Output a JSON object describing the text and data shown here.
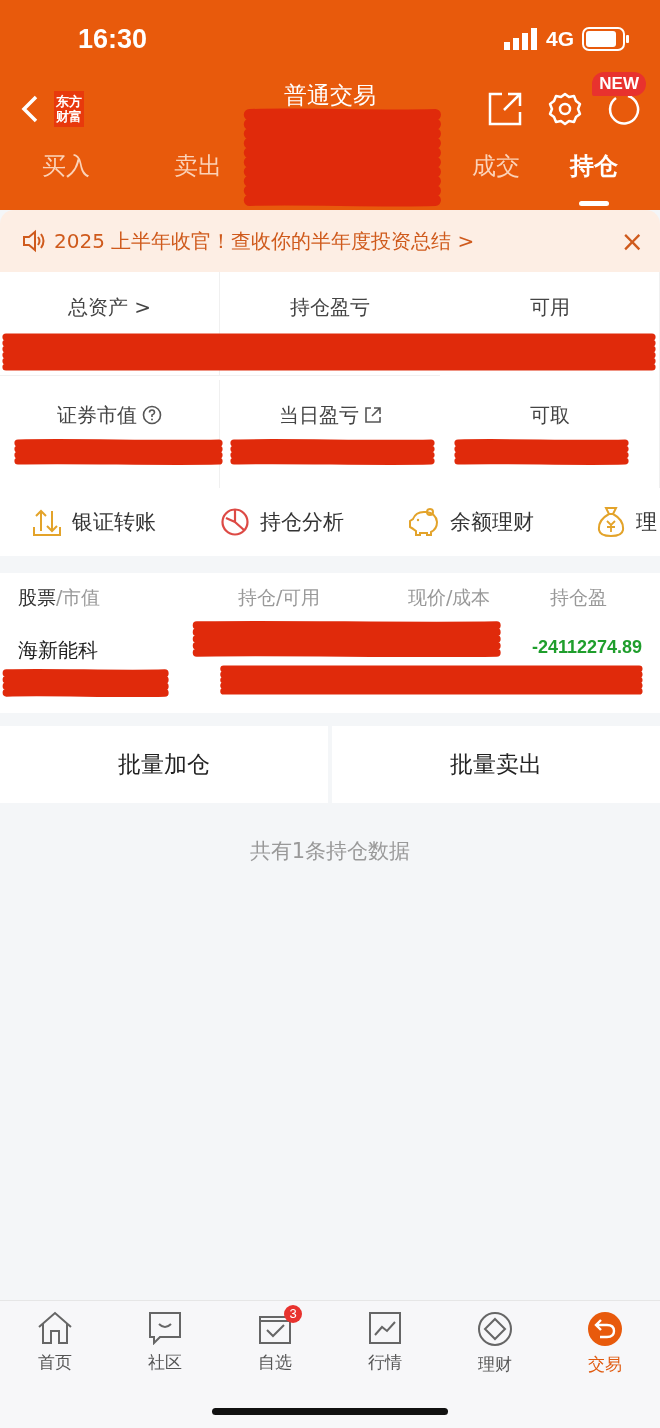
{
  "status_bar": {
    "time": "16:30",
    "network": "4G"
  },
  "header": {
    "logo_lines": [
      "东方",
      "财富"
    ],
    "title": "普通交易",
    "badge": "NEW"
  },
  "tabs": [
    {
      "label": "买入",
      "selected": false
    },
    {
      "label": "卖出",
      "selected": false
    },
    {
      "label": "成交",
      "selected": false
    },
    {
      "label": "持仓",
      "selected": true
    }
  ],
  "banner": {
    "text": "2025 上半年收官！查收你的半年度投资总结 >",
    "close": "×"
  },
  "summary": [
    {
      "label": "总资产 >"
    },
    {
      "label": "持仓盈亏"
    },
    {
      "label": "可用"
    },
    {
      "label": "证券市值"
    },
    {
      "label": "当日盈亏"
    },
    {
      "label": "可取"
    }
  ],
  "shortcuts": [
    {
      "label": "银证转账"
    },
    {
      "label": "持仓分析"
    },
    {
      "label": "余额理财"
    },
    {
      "label": "理"
    }
  ],
  "holdings": {
    "columns": [
      {
        "main": "股票",
        "sub": "/市值"
      },
      {
        "main": "持仓",
        "sub": "/可用"
      },
      {
        "main": "现价",
        "sub": "/成本"
      },
      {
        "main": "持仓盈"
      }
    ],
    "rows": [
      {
        "name": "海新能科",
        "profit": "-24112274.89"
      }
    ]
  },
  "actions": [
    "批量加仓",
    "批量卖出"
  ],
  "footer_note": "共有1条持仓数据",
  "nav": [
    {
      "label": "首页",
      "selected": false
    },
    {
      "label": "社区",
      "selected": false
    },
    {
      "label": "自选",
      "selected": false,
      "badge": "3"
    },
    {
      "label": "行情",
      "selected": false
    },
    {
      "label": "理财",
      "selected": false
    },
    {
      "label": "交易",
      "selected": true
    }
  ]
}
